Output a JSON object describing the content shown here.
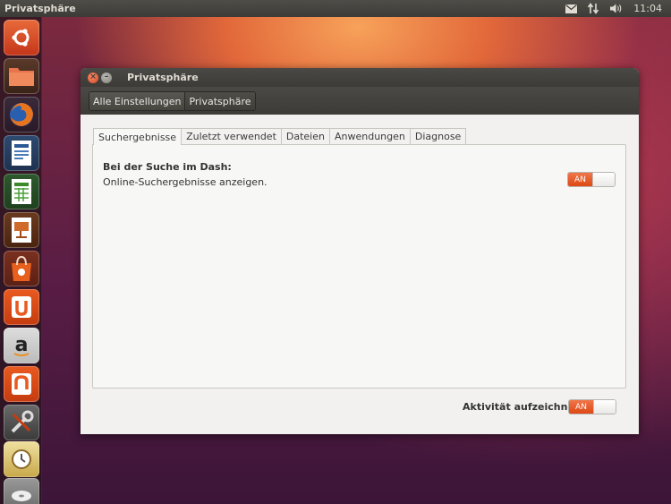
{
  "top_panel": {
    "title": "Privatsphäre",
    "clock": "11:04",
    "icons": [
      "mail-icon",
      "network-icon",
      "volume-icon"
    ]
  },
  "launcher": {
    "items": [
      "ubuntu-logo-icon",
      "files-icon",
      "firefox-icon",
      "writer-icon",
      "calc-icon",
      "impress-icon",
      "software-center-icon",
      "ubuntu-one-icon",
      "amazon-icon",
      "ubuntu-one-music-icon",
      "system-settings-icon",
      "backup-icon",
      "disk-icon"
    ]
  },
  "window": {
    "title": "Privatsphäre",
    "breadcrumbs": [
      "Alle Einstellungen",
      "Privatsphäre"
    ],
    "tabs": [
      "Suchergebnisse",
      "Zuletzt verwendet",
      "Dateien",
      "Anwendungen",
      "Diagnose"
    ],
    "active_tab": "Suchergebnisse",
    "search_section": {
      "heading": "Bei der Suche im Dash:",
      "description": "Online-Suchergebnisse anzeigen.",
      "toggle_label": "AN"
    },
    "record_activity": {
      "label": "Aktivität aufzeichnen",
      "toggle_label": "AN"
    }
  },
  "colors": {
    "accent": "#dd4814",
    "panel_dark": "#3c3b37",
    "window_bg": "#f2f1f0"
  }
}
